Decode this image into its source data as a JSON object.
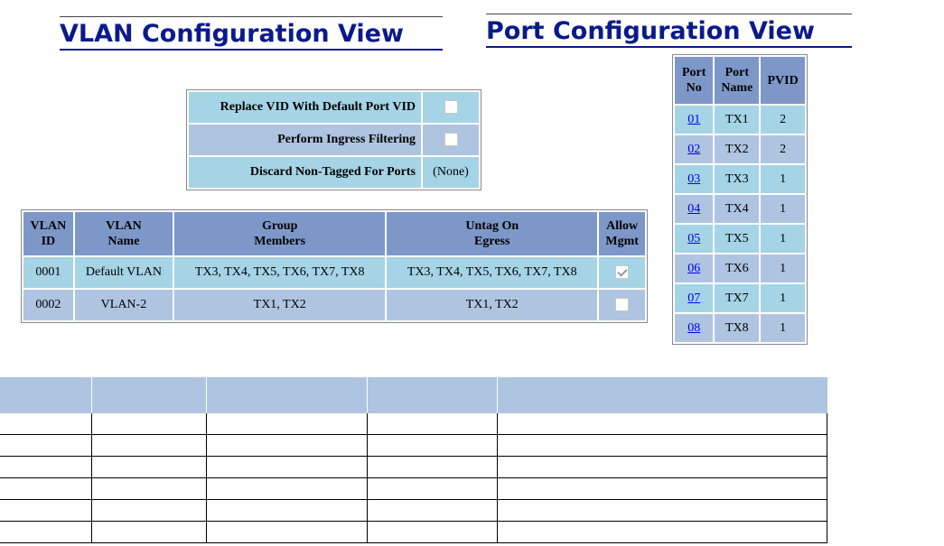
{
  "titles": {
    "vlan_view": "VLAN Configuration View",
    "port_view": "Port Configuration View"
  },
  "options": [
    {
      "label": "Replace VID With Default Port VID",
      "type": "checkbox",
      "checked": false
    },
    {
      "label": "Perform Ingress Filtering",
      "type": "checkbox",
      "checked": false
    },
    {
      "label": "Discard Non-Tagged For Ports",
      "type": "text",
      "value": "(None)"
    }
  ],
  "vlan_table": {
    "headers": {
      "id_l1": "VLAN",
      "id_l2": "ID",
      "name_l1": "VLAN",
      "name_l2": "Name",
      "group_l1": "Group",
      "group_l2": "Members",
      "untag_l1": "Untag On",
      "untag_l2": "Egress",
      "allow_l1": "Allow",
      "allow_l2": "Mgmt"
    },
    "rows": [
      {
        "id": "0001",
        "name": "Default VLAN",
        "members": "TX3, TX4, TX5, TX6, TX7, TX8",
        "untag": "TX3, TX4, TX5, TX6, TX7, TX8",
        "allow_mgmt": true
      },
      {
        "id": "0002",
        "name": "VLAN-2",
        "members": "TX1, TX2",
        "untag": "TX1, TX2",
        "allow_mgmt": false
      }
    ]
  },
  "port_table": {
    "headers": {
      "no_l1": "Port",
      "no_l2": "No",
      "name_l1": "Port",
      "name_l2": "Name",
      "pvid": "PVID"
    },
    "rows": [
      {
        "no": "01",
        "name": "TX1",
        "pvid": "2"
      },
      {
        "no": "02",
        "name": "TX2",
        "pvid": "2"
      },
      {
        "no": "03",
        "name": "TX3",
        "pvid": "1"
      },
      {
        "no": "04",
        "name": "TX4",
        "pvid": "1"
      },
      {
        "no": "05",
        "name": "TX5",
        "pvid": "1"
      },
      {
        "no": "06",
        "name": "TX6",
        "pvid": "1"
      },
      {
        "no": "07",
        "name": "TX7",
        "pvid": "1"
      },
      {
        "no": "08",
        "name": "TX8",
        "pvid": "1"
      }
    ]
  },
  "colors": {
    "title": "#0a1a8c",
    "header_bg": "#7d98c8",
    "row_cyan": "#a4d4e6",
    "row_blue": "#aec4e0",
    "link": "#0000ee"
  }
}
